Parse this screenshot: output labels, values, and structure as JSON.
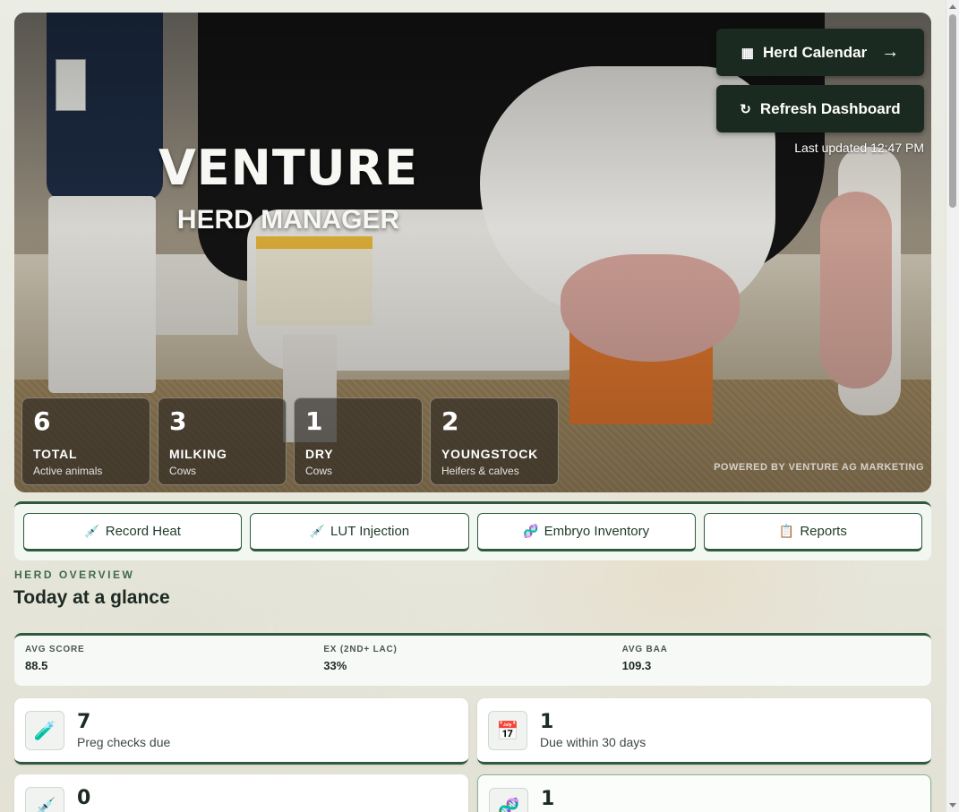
{
  "hero": {
    "logo_word": "VENTURE",
    "logo_sub": "HERD MANAGER",
    "calendar_button": {
      "icon": "▦",
      "label": "Herd Calendar",
      "arrow": "→"
    },
    "refresh_button": {
      "icon": "↻",
      "label": "Refresh Dashboard"
    },
    "last_updated": "Last updated 12:47 PM",
    "powered_by": "POWERED BY VENTURE AG MARKETING",
    "stats": [
      {
        "num": "6",
        "label": "TOTAL",
        "sub": "Active animals"
      },
      {
        "num": "3",
        "label": "MILKING",
        "sub": "Cows"
      },
      {
        "num": "1",
        "label": "DRY",
        "sub": "Cows"
      },
      {
        "num": "2",
        "label": "YOUNGSTOCK",
        "sub": "Heifers & calves"
      }
    ]
  },
  "actions": [
    {
      "icon": "💉",
      "label": "Record Heat"
    },
    {
      "icon": "💉",
      "label": "LUT Injection"
    },
    {
      "icon": "🧬",
      "label": "Embryo Inventory"
    },
    {
      "icon": "📋",
      "label": "Reports"
    }
  ],
  "overview": {
    "eyebrow": "HERD OVERVIEW",
    "title": "Today at a glance",
    "metrics": [
      {
        "key": "AVG SCORE",
        "value": "88.5"
      },
      {
        "key": "EX (2ND+ LAC)",
        "value": "33%"
      },
      {
        "key": "AVG BAA",
        "value": "109.3"
      }
    ],
    "tasks": [
      {
        "icon": "🧪",
        "count": "7",
        "desc": "Preg checks due"
      },
      {
        "icon": "📅",
        "count": "1",
        "desc": "Due within 30 days"
      },
      {
        "icon": "💉",
        "count": "0",
        "desc": ""
      },
      {
        "icon": "🧬",
        "count": "1",
        "desc": ""
      }
    ]
  }
}
